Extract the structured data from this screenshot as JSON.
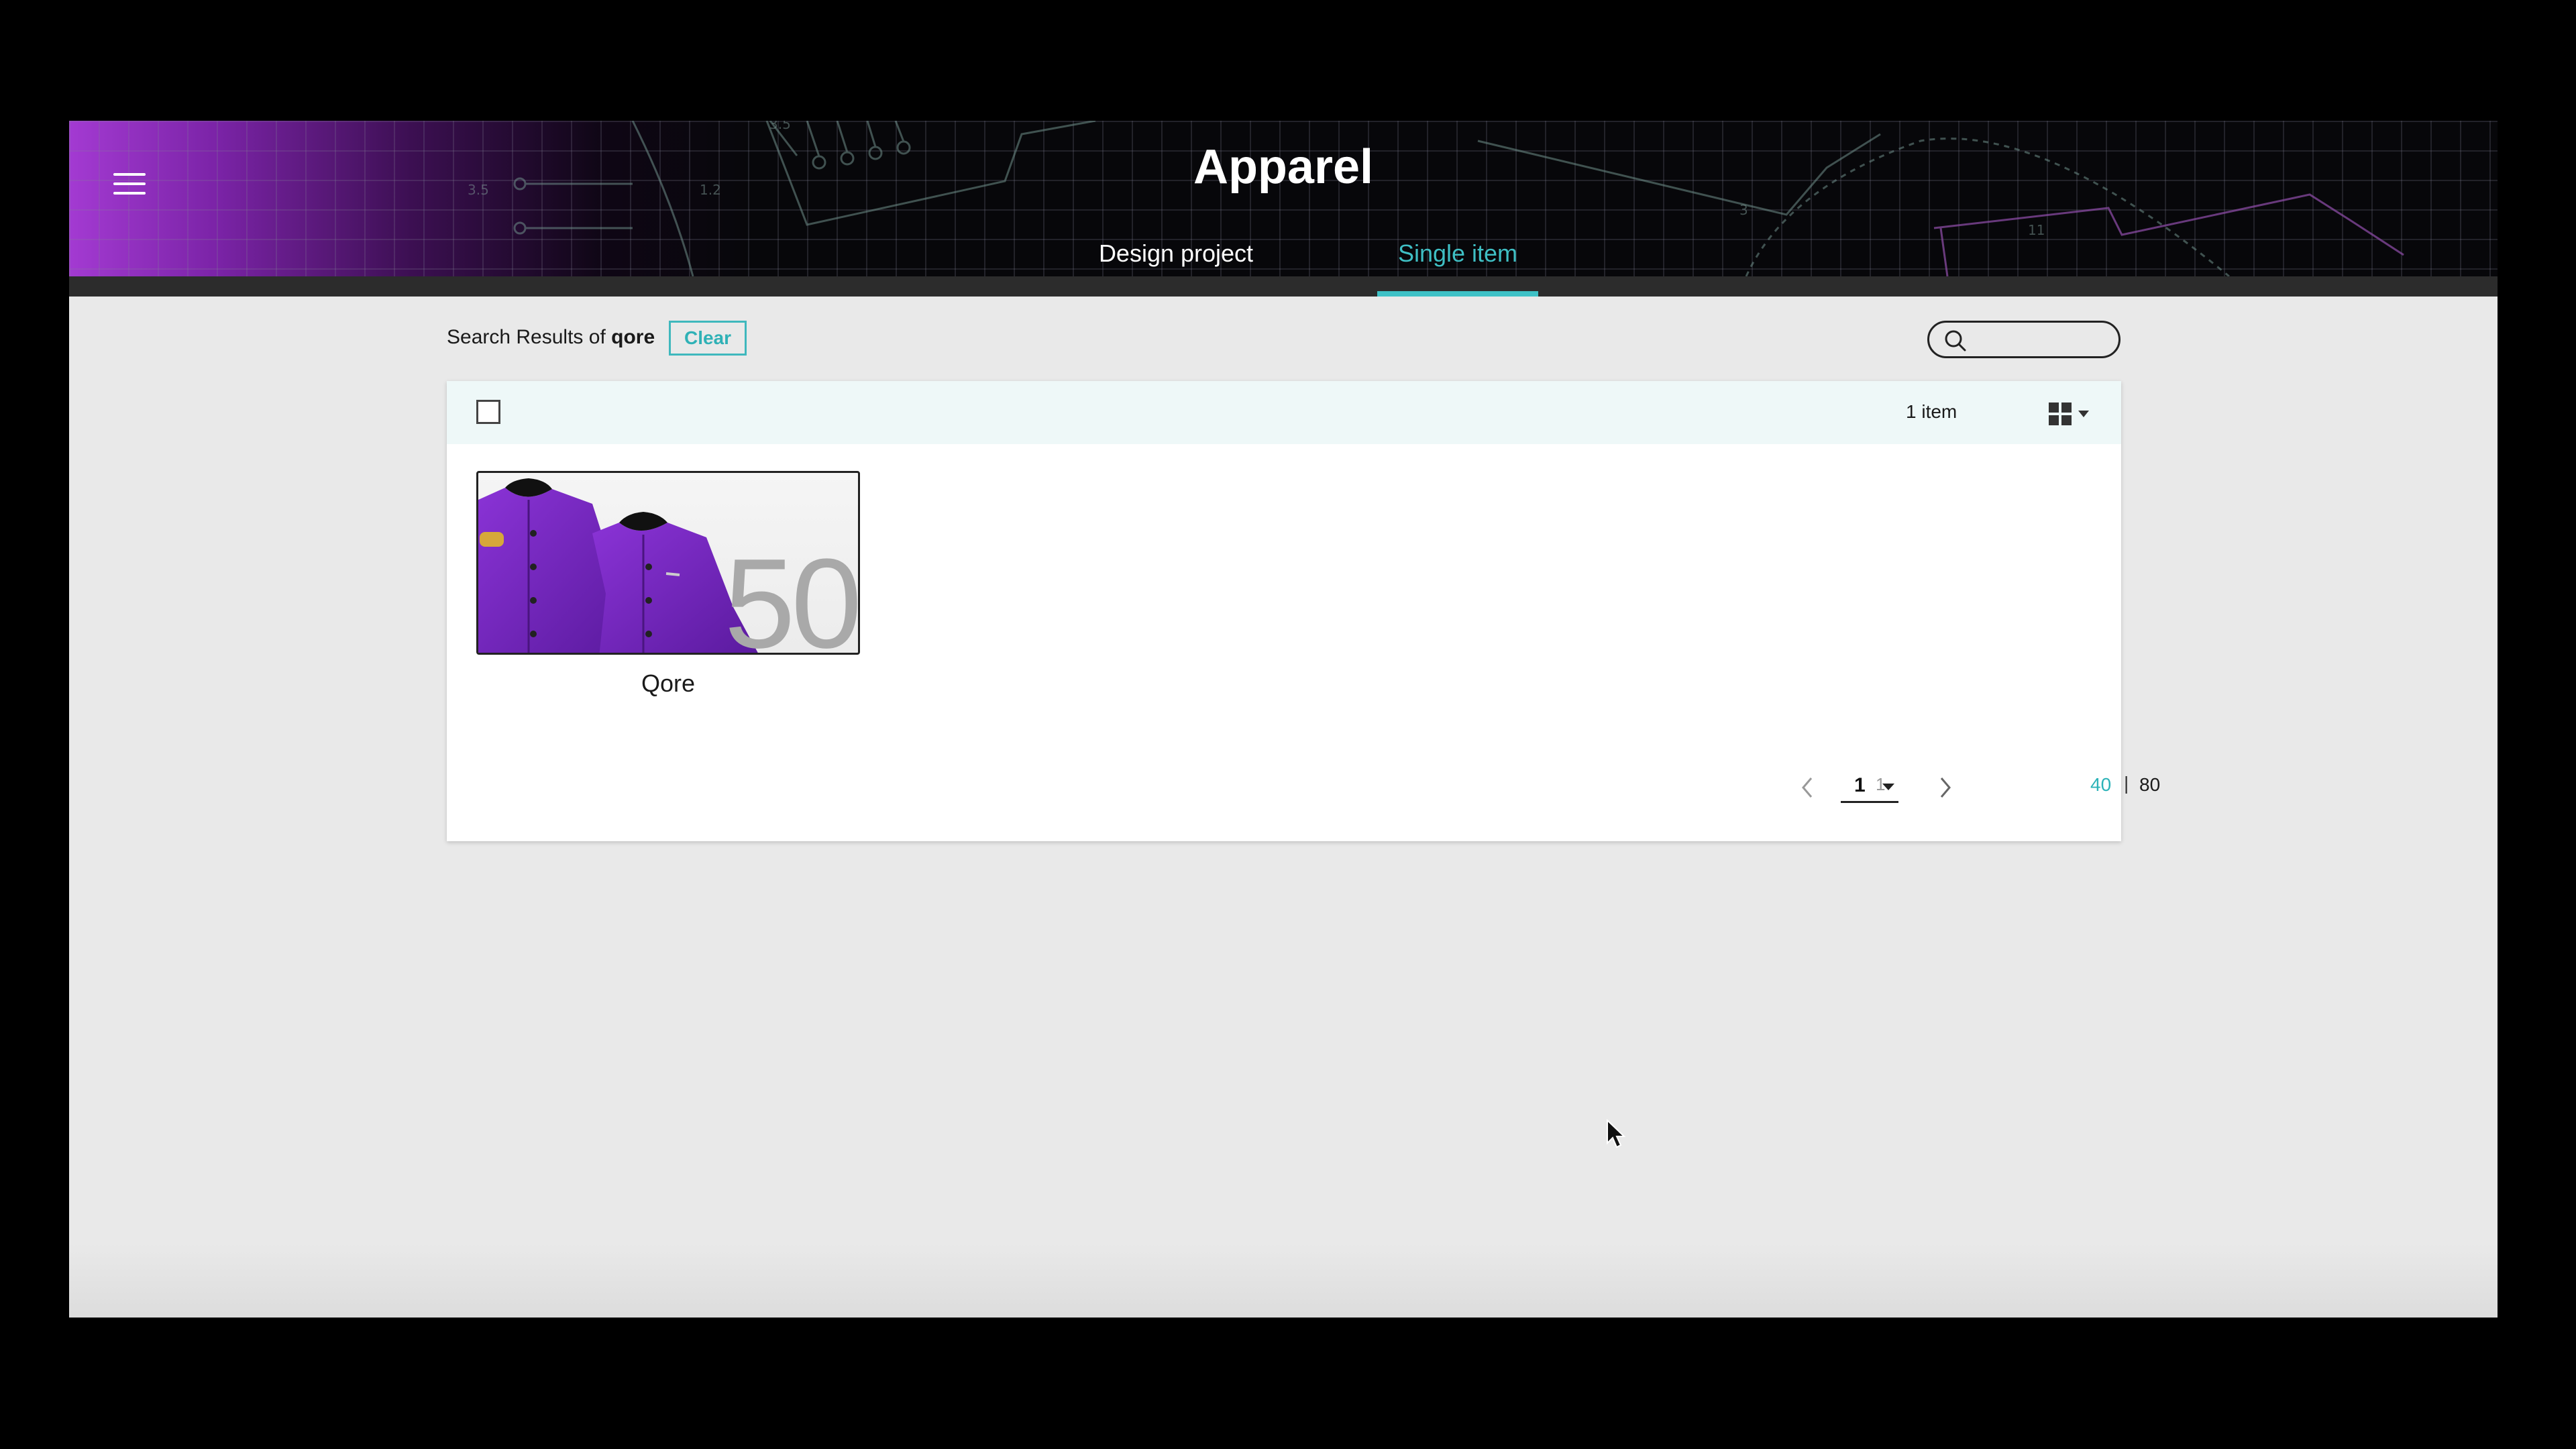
{
  "header": {
    "title": "Apparel",
    "tabs": [
      {
        "label": "Design project",
        "active": false
      },
      {
        "label": "Single item",
        "active": true
      }
    ],
    "accent_color": "#3ec1c6",
    "banner_gradient_color": "#a33ad2"
  },
  "search": {
    "results_prefix": "Search Results of",
    "query": "qore",
    "clear_label": "Clear",
    "placeholder": ""
  },
  "results": {
    "count_label": "1 item",
    "view_mode": "grid",
    "items": [
      {
        "name": "Qore",
        "badge": "50",
        "thumbnail": "purple-jackets"
      }
    ]
  },
  "pagination": {
    "current_page": "1",
    "total_pages": "1",
    "page_sizes": [
      "40",
      "80"
    ],
    "selected_page_size": "40",
    "separator": "|"
  }
}
